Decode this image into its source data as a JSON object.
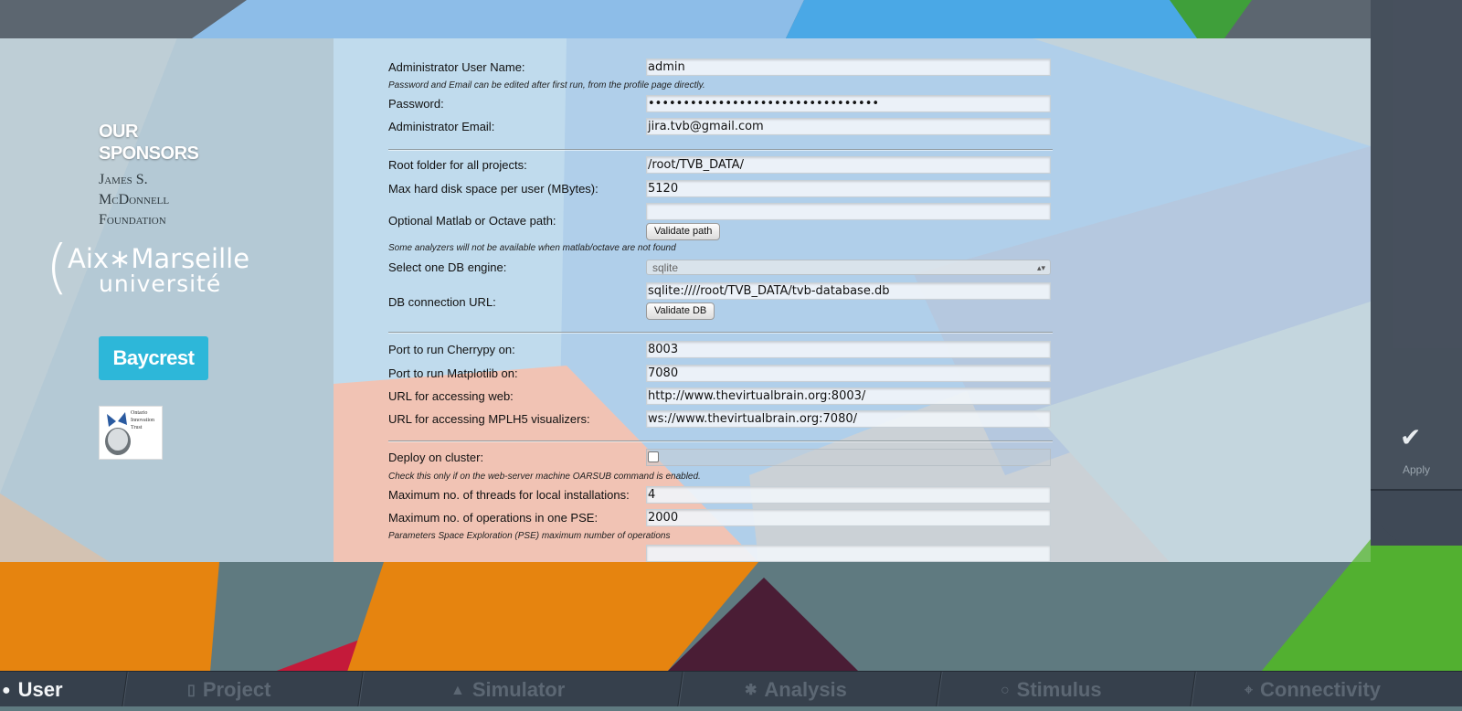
{
  "sponsors": {
    "title_line1": "OUR",
    "title_line2": "SPONSORS",
    "mcdonnell_line1": "James S.",
    "mcdonnell_line2": "McDonnell",
    "mcdonnell_line3": "Foundation",
    "amu_line1": "Aix∗Marseille",
    "amu_line2": "université",
    "baycrest": "Baycrest",
    "oit_line1": "Ontario",
    "oit_line2": "Innovation",
    "oit_line3": "Trust"
  },
  "form": {
    "admin_name_label": "Administrator User Name:",
    "admin_name_value": "admin",
    "admin_hint": "Password and Email can be edited after first run, from the profile page directly.",
    "password_label": "Password:",
    "password_value": "•••••••••••••••••••••••••••••••••",
    "email_label": "Administrator Email:",
    "email_value": "jira.tvb@gmail.com",
    "root_label": "Root folder for all projects:",
    "root_value": "/root/TVB_DATA/",
    "disk_label": "Max hard disk space per user (MBytes):",
    "disk_value": "5120",
    "matlab_label": "Optional Matlab or Octave path:",
    "matlab_value": "",
    "validate_path": "Validate path",
    "matlab_hint": "Some analyzers will not be available when matlab/octave are not found",
    "db_engine_label": "Select one DB engine:",
    "db_engine_value": "sqlite",
    "db_url_label": "DB connection URL:",
    "db_url_value": "sqlite:////root/TVB_DATA/tvb-database.db",
    "validate_db": "Validate DB",
    "cherrypy_label": "Port to run Cherrypy on:",
    "cherrypy_value": "8003",
    "matplotlib_label": "Port to run Matplotlib on:",
    "matplotlib_value": "7080",
    "web_url_label": "URL for accessing web:",
    "web_url_value": "http://www.thevirtualbrain.org:8003/",
    "mplh5_label": "URL for accessing MPLH5 visualizers:",
    "mplh5_value": "ws://www.thevirtualbrain.org:7080/",
    "cluster_label": "Deploy on cluster:",
    "cluster_checked": false,
    "cluster_hint": "Check this only if on the web-server machine OARSUB command is enabled.",
    "threads_label": "Maximum no. of threads for local installations:",
    "threads_value": "4",
    "pse_label": "Maximum no. of operations in one PSE:",
    "pse_value": "2000",
    "pse_hint": "Parameters Space Exploration (PSE) maximum number of operations"
  },
  "right_panel": {
    "apply_label": "Apply",
    "apply_icon": "checkmark-icon"
  },
  "nav": {
    "tabs": [
      {
        "label": "User",
        "icon": "user-icon",
        "active": true
      },
      {
        "label": "Project",
        "icon": "document-icon",
        "active": false
      },
      {
        "label": "Simulator",
        "icon": "flask-icon",
        "active": false
      },
      {
        "label": "Analysis",
        "icon": "gear-icon",
        "active": false
      },
      {
        "label": "Stimulus",
        "icon": "pin-icon",
        "active": false
      },
      {
        "label": "Connectivity",
        "icon": "network-icon",
        "active": false
      }
    ]
  },
  "colors": {
    "nav_bg": "#36404c",
    "active_tab": "#f3f5f7",
    "inactive_tab": "#5c6773",
    "baycrest": "#2db7d9"
  }
}
